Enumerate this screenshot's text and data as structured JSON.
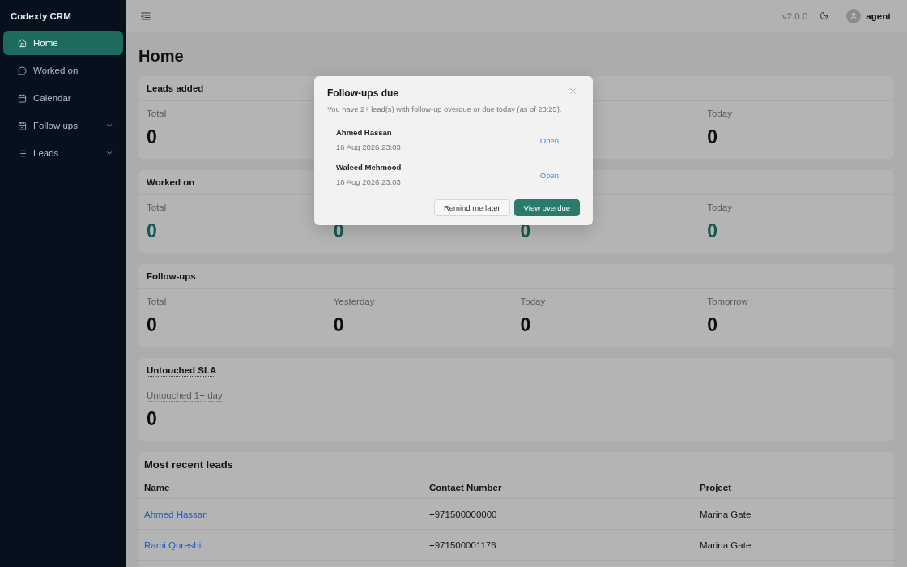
{
  "sidebar": {
    "brand": "Codexty CRM",
    "items": [
      {
        "label": "Home",
        "kind": "link",
        "selected": true
      },
      {
        "label": "Worked on",
        "kind": "link",
        "selected": false
      },
      {
        "label": "Calendar",
        "kind": "link",
        "selected": false
      },
      {
        "label": "Follow ups",
        "kind": "group",
        "selected": false
      },
      {
        "label": "Leads",
        "kind": "group",
        "selected": false
      }
    ]
  },
  "top_bar": {
    "version": "v2.0.0",
    "user": "agent"
  },
  "page_title": "Home",
  "cards": [
    {
      "kind": "stats",
      "title": "Leads added",
      "color": "#0d0d0d",
      "stats": [
        {
          "label": "Total",
          "value": "0"
        },
        {
          "label": "Today",
          "value": "0"
        }
      ]
    },
    {
      "kind": "stats",
      "title": "Worked on",
      "color": "#0f5a4e",
      "stats": [
        {
          "label": "Total",
          "value": "0"
        },
        {
          "value": "0"
        },
        {
          "value": "0"
        },
        {
          "label": "Today",
          "value": "0"
        }
      ]
    },
    {
      "kind": "stats",
      "title": "Follow-ups",
      "color": "#0d0d0d",
      "stats": [
        {
          "label": "Total",
          "value": "0"
        },
        {
          "label": "Yesterday",
          "value": "0"
        },
        {
          "label": "Today",
          "value": "0"
        },
        {
          "label": "Tomorrow",
          "value": "0"
        }
      ]
    },
    {
      "kind": "sla",
      "title": "Untouched SLA",
      "color": "#0d0d0d",
      "stats": [
        {
          "label": "Untouched 1+ day",
          "value": "0"
        }
      ]
    }
  ],
  "recent_leads": {
    "title": "Most recent leads",
    "columns": [
      "Name",
      "Contact Number",
      "Project"
    ],
    "rows": [
      [
        "Ahmed Hassan",
        "+971500000000",
        "Marina Gate"
      ],
      [
        "Rami Qureshi",
        "+971500001176",
        "Marina Gate"
      ]
    ]
  },
  "dialog": {
    "title": "Follow-ups due",
    "message": "You have 2+ lead(s) with follow-up overdue or due today (as of 23:25).",
    "items": [
      {
        "name": "Ahmed Hassan",
        "due": "16 Aug 2026 23:03",
        "action": "Open"
      },
      {
        "name": "Waleed Mehmood",
        "due": "16 Aug 2026 23:03",
        "action": "Open"
      }
    ],
    "buttons": [
      {
        "label": "Remind me later",
        "kind": "secondary"
      },
      {
        "label": "View overdue",
        "kind": "primary"
      }
    ]
  }
}
